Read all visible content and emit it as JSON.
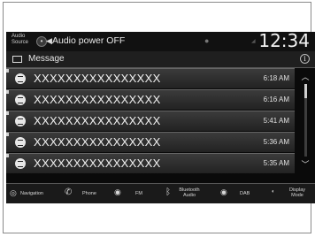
{
  "status": {
    "audio_source_label": "Audio Source",
    "audio_power_text": "Audio power OFF",
    "clock": "12:34"
  },
  "header": {
    "title": "Message"
  },
  "messages": [
    {
      "sender": "XXXXXXXXXXXXXXXX",
      "time": "6:18 AM"
    },
    {
      "sender": "XXXXXXXXXXXXXXXX",
      "time": "6:16 AM"
    },
    {
      "sender": "XXXXXXXXXXXXXXXX",
      "time": "5:41 AM"
    },
    {
      "sender": "XXXXXXXXXXXXXXXX",
      "time": "5:36 AM"
    },
    {
      "sender": "XXXXXXXXXXXXXXXX",
      "time": "5:35 AM"
    }
  ],
  "bottom_nav": {
    "navigation": "Navigation",
    "phone": "Phone",
    "fm": "FM",
    "bluetooth_audio": "Bluetooth Audio",
    "dab": "DAB",
    "display_mode": "Display Mode"
  }
}
